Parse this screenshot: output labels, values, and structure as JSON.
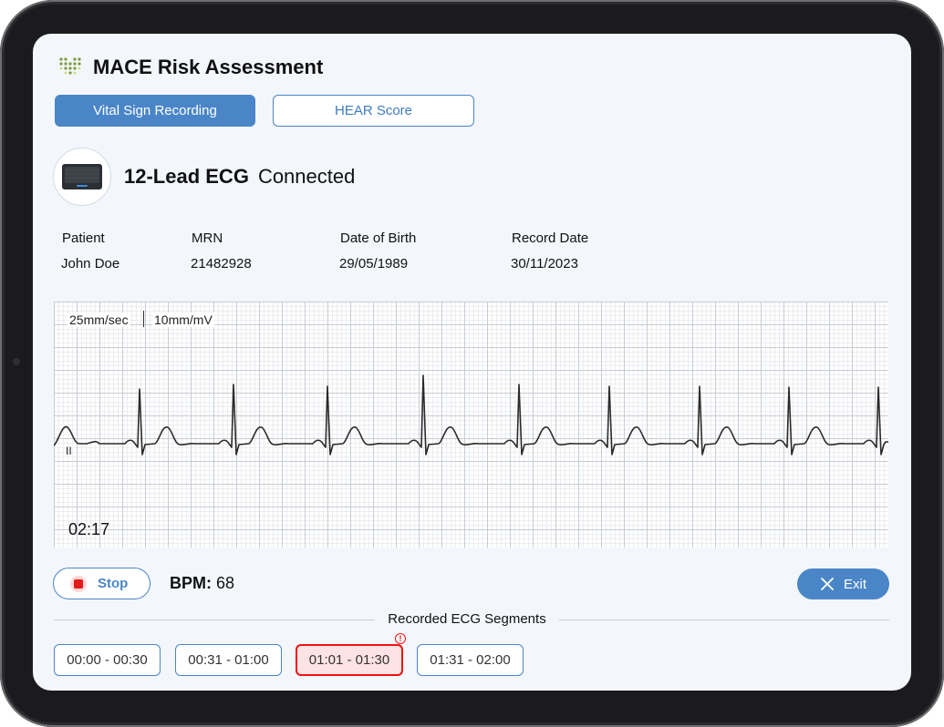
{
  "app": {
    "title": "MACE Risk Assessment"
  },
  "tabs": [
    {
      "label": "Vital Sign Recording",
      "active": true
    },
    {
      "label": "HEAR Score",
      "active": false
    }
  ],
  "device": {
    "name": "12-Lead ECG",
    "status": "Connected",
    "icon": "ecg-monitor-device-icon"
  },
  "patient_info": {
    "headers": [
      "Patient",
      "MRN",
      "Date of Birth",
      "Record Date"
    ],
    "values": [
      "John Doe",
      "21482928",
      "29/05/1989",
      "30/11/2023"
    ]
  },
  "ecg": {
    "speed": "25mm/sec",
    "gain": "10mm/mV",
    "lead": "II",
    "timer": "02:17",
    "trace_color": "#2a2a2a"
  },
  "controls": {
    "stop_label": "Stop",
    "bpm_label": "BPM:",
    "bpm_value": "68",
    "exit_label": "Exit"
  },
  "segments": {
    "title": "Recorded ECG Segments",
    "items": [
      {
        "label": "00:00 - 00:30",
        "alert": false
      },
      {
        "label": "00:31 - 01:00",
        "alert": false
      },
      {
        "label": "01:01 - 01:30",
        "alert": true
      },
      {
        "label": "01:31 - 02:00",
        "alert": false
      }
    ],
    "alert_glyph": "!"
  },
  "colors": {
    "accent": "#4a86c7",
    "alert": "#e11111",
    "background": "#f3f6fb"
  }
}
